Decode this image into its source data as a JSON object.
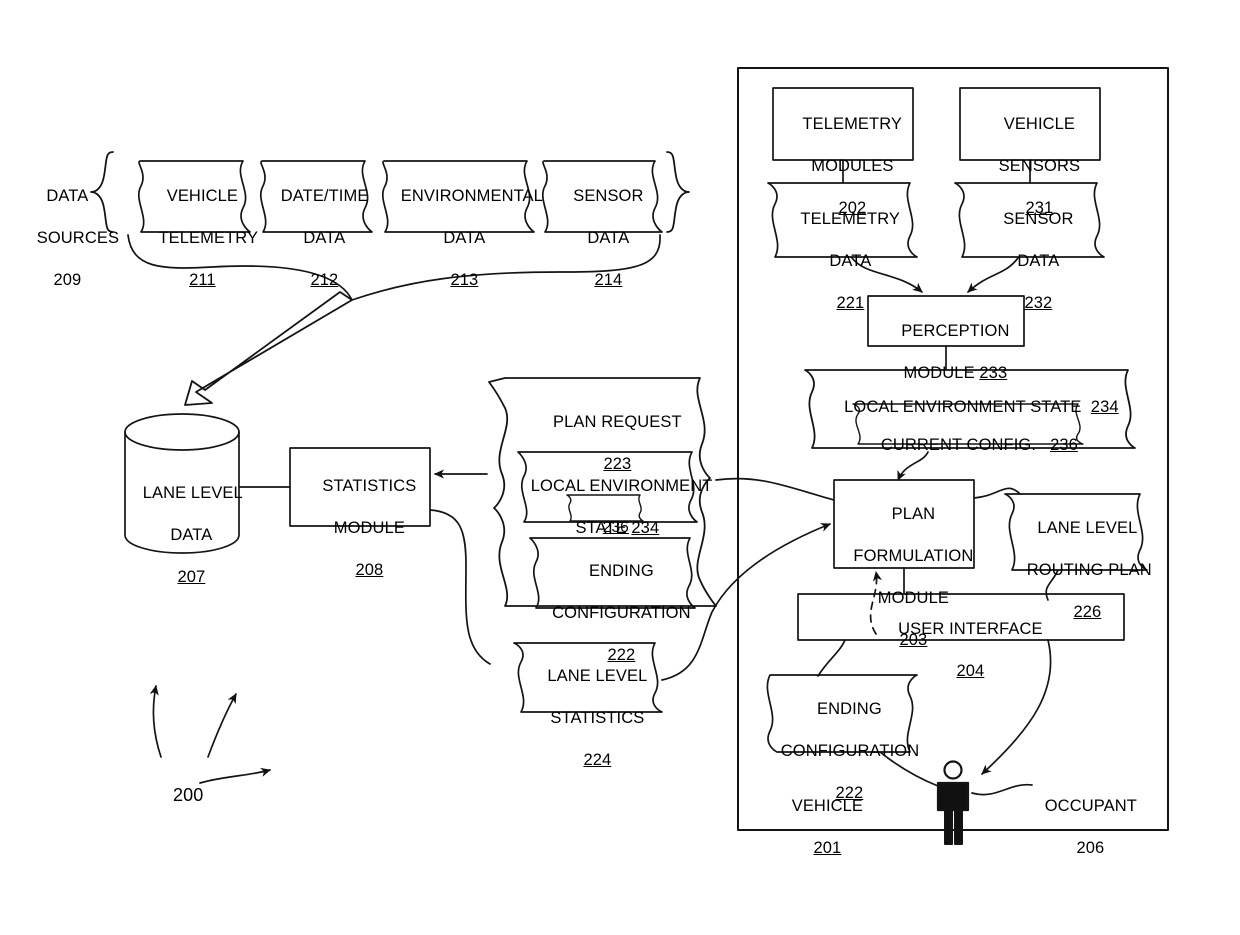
{
  "figure": {
    "number": "200",
    "data_sources_group": {
      "label_line1": "DATA",
      "label_line2": "SOURCES",
      "ref": "209",
      "items": [
        {
          "line1": "VEHICLE",
          "line2": "TELEMETRY",
          "ref": "211"
        },
        {
          "line1": "DATE/TIME",
          "line2": "DATA",
          "ref": "212"
        },
        {
          "line1": "ENVIRONMENTAL",
          "line2": "DATA",
          "ref": "213"
        },
        {
          "line1": "SENSOR",
          "line2": "DATA",
          "ref": "214"
        }
      ]
    },
    "datastore": {
      "line1": "LANE LEVEL",
      "line2": "DATA",
      "ref": "207"
    },
    "statistics_module": {
      "line1": "STATISTICS",
      "line2": "MODULE",
      "ref": "208"
    },
    "plan_request": {
      "title": "PLAN REQUEST",
      "ref": "223",
      "local_environment_state": {
        "line1": "LOCAL ENVIRONMENT",
        "line2": "STATE",
        "ref": "234",
        "nested_ref": "236"
      },
      "ending_configuration": {
        "line1": "ENDING",
        "line2": "CONFIGURATION",
        "ref": "222"
      }
    },
    "lane_level_statistics": {
      "line1": "LANE LEVEL",
      "line2": "STATISTICS",
      "ref": "224"
    },
    "vehicle": {
      "label": "VEHICLE",
      "ref": "201",
      "telemetry_modules": {
        "line1": "TELEMETRY",
        "line2": "MODULES",
        "ref": "202"
      },
      "vehicle_sensors": {
        "line1": "VEHICLE",
        "line2": "SENSORS",
        "ref": "231"
      },
      "telemetry_data": {
        "line1": "TELEMETRY",
        "line2": "DATA",
        "ref": "221"
      },
      "sensor_data": {
        "line1": "SENSOR",
        "line2": "DATA",
        "ref": "232"
      },
      "perception_module": {
        "line1": "PERCEPTION",
        "line2": "MODULE",
        "ref": "233"
      },
      "local_environment_state": {
        "title": "LOCAL ENVIRONMENT STATE",
        "ref": "234",
        "current_config_label": "CURRENT CONFIG.",
        "current_config_ref": "236"
      },
      "plan_formulation_module": {
        "line1": "PLAN",
        "line2": "FORMULATION",
        "line3": "MODULE",
        "ref": "203"
      },
      "lane_level_routing_plan": {
        "line1": "LANE LEVEL",
        "line2": "ROUTING PLAN",
        "ref": "226"
      },
      "user_interface": {
        "label": "USER INTERFACE",
        "ref": "204"
      },
      "ending_configuration": {
        "line1": "ENDING",
        "line2": "CONFIGURATION",
        "ref": "222"
      },
      "occupant": {
        "label": "OCCUPANT",
        "ref": "206"
      }
    }
  },
  "colors": {
    "stroke": "#1a1a1a",
    "background": "#ffffff"
  }
}
